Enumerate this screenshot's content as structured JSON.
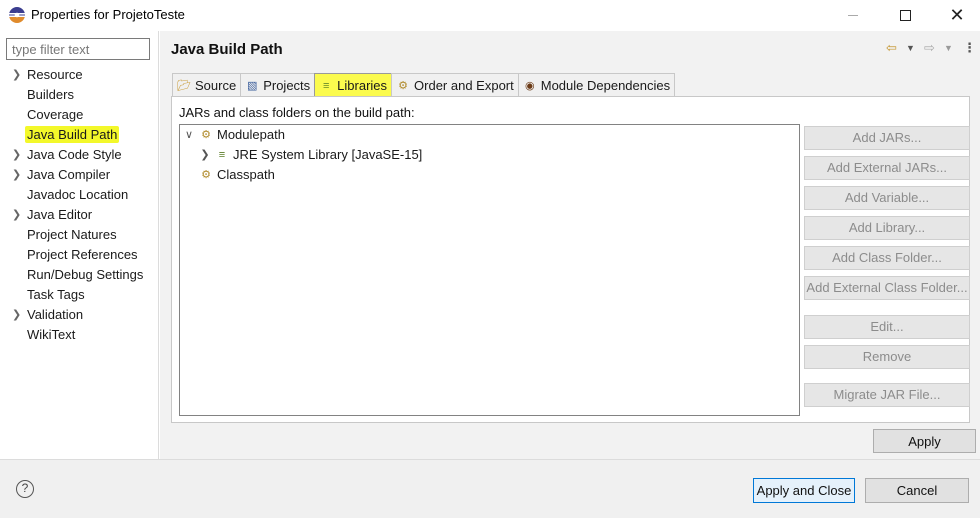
{
  "window": {
    "title": "Properties for ProjetoTeste",
    "minimize_icon": "minimize-icon",
    "maximize_icon": "maximize-icon",
    "close_glyph": "✕"
  },
  "sidebar": {
    "filter_placeholder": "type filter text",
    "items": [
      {
        "label": "Resource",
        "expandable": true
      },
      {
        "label": "Builders",
        "expandable": false
      },
      {
        "label": "Coverage",
        "expandable": false
      },
      {
        "label": "Java Build Path",
        "expandable": false,
        "selected": true
      },
      {
        "label": "Java Code Style",
        "expandable": true
      },
      {
        "label": "Java Compiler",
        "expandable": true
      },
      {
        "label": "Javadoc Location",
        "expandable": false
      },
      {
        "label": "Java Editor",
        "expandable": true
      },
      {
        "label": "Project Natures",
        "expandable": false
      },
      {
        "label": "Project References",
        "expandable": false
      },
      {
        "label": "Run/Debug Settings",
        "expandable": false
      },
      {
        "label": "Task Tags",
        "expandable": false
      },
      {
        "label": "Validation",
        "expandable": true
      },
      {
        "label": "WikiText",
        "expandable": false
      }
    ],
    "selection_highlight_color": "#f3f82a"
  },
  "page": {
    "title": "Java Build Path"
  },
  "tabs": [
    {
      "label": "Source",
      "icon": "source-folder-icon"
    },
    {
      "label": "Projects",
      "icon": "projects-icon"
    },
    {
      "label": "Libraries",
      "icon": "library-icon",
      "active": true
    },
    {
      "label": "Order and Export",
      "icon": "order-export-icon"
    },
    {
      "label": "Module Dependencies",
      "icon": "module-icon"
    }
  ],
  "libraries": {
    "description": "JARs and class folders on the build path:",
    "tree": {
      "modulepath": "Modulepath",
      "jre": "JRE System Library [JavaSE-15]",
      "classpath": "Classpath"
    },
    "buttons": {
      "add_jars": "Add JARs...",
      "add_external_jars": "Add External JARs...",
      "add_variable": "Add Variable...",
      "add_library": "Add Library...",
      "add_class_folder": "Add Class Folder...",
      "add_external_class_folder": "Add External Class Folder...",
      "edit": "Edit...",
      "remove": "Remove",
      "migrate_jar": "Migrate JAR File..."
    },
    "apply": "Apply"
  },
  "footer": {
    "help": "?",
    "apply_and_close": "Apply and Close",
    "cancel": "Cancel"
  }
}
